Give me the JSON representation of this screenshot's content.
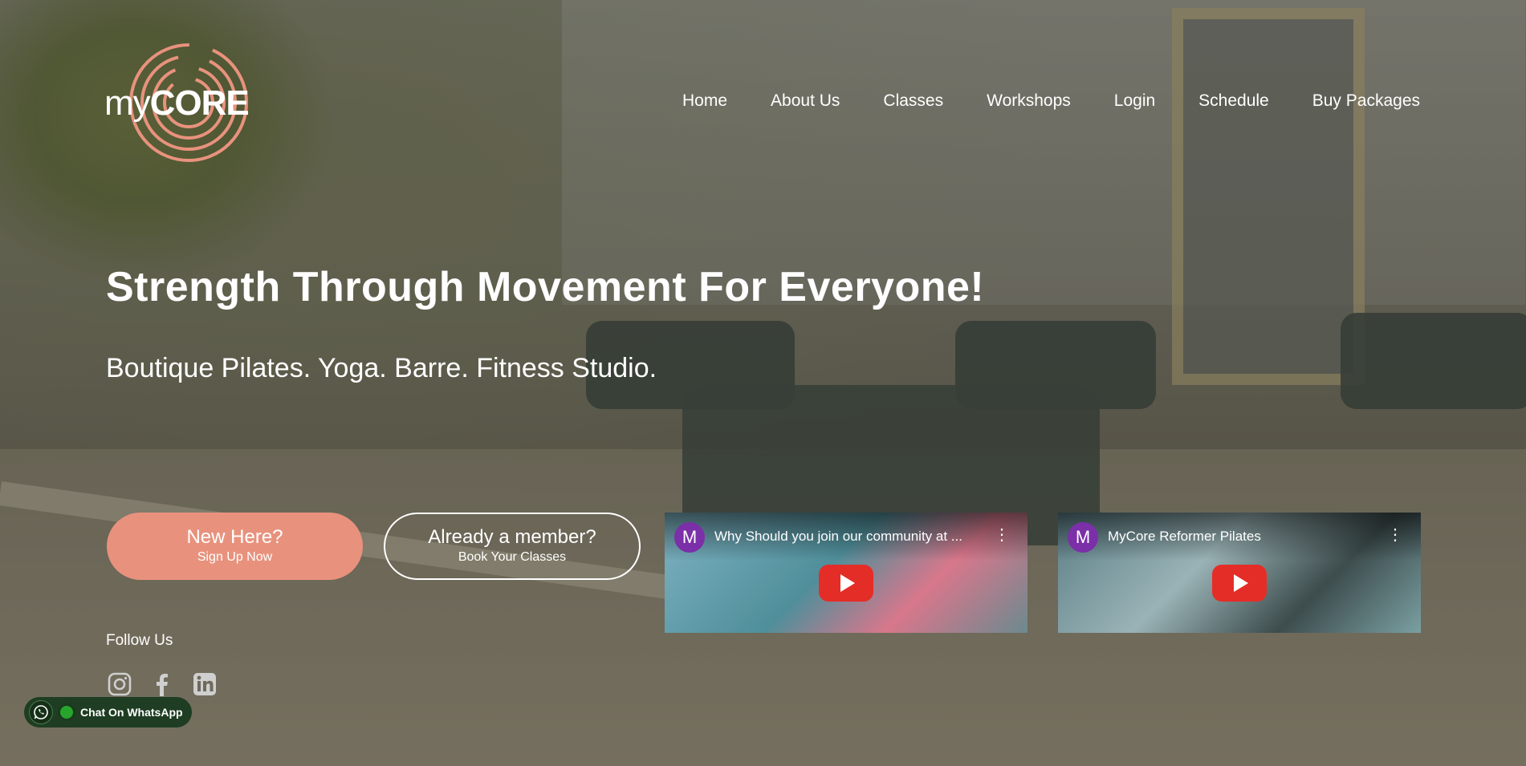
{
  "brand": {
    "logo_prefix": "my",
    "logo_suffix": "CORE",
    "accent_color": "#e8927d"
  },
  "nav": {
    "items": [
      "Home",
      "About Us",
      "Classes",
      "Workshops",
      "Login",
      "Schedule",
      "Buy Packages"
    ]
  },
  "hero": {
    "title": "Strength Through Movement For Everyone!",
    "subtitle": "Boutique Pilates. Yoga. Barre. Fitness Studio."
  },
  "cta": {
    "new_line1": "New Here?",
    "new_line2": "Sign Up Now",
    "member_line1": "Already a member?",
    "member_line2": "Book Your Classes"
  },
  "videos": [
    {
      "avatar": "M",
      "title": "Why Should you join our community at ...",
      "icon": "youtube-play-icon"
    },
    {
      "avatar": "M",
      "title": "MyCore Reformer Pilates",
      "icon": "youtube-play-icon"
    }
  ],
  "social": {
    "label": "Follow Us",
    "icons": [
      "instagram-icon",
      "facebook-icon",
      "linkedin-icon"
    ]
  },
  "whatsapp": {
    "label": "Chat On WhatsApp",
    "color": "#27a52c"
  }
}
